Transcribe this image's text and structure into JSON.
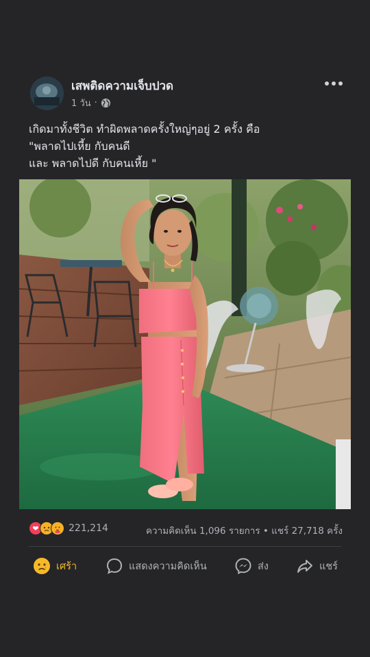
{
  "post": {
    "author": "เสพติดความเจ็บปวด",
    "time": "1 วัน",
    "time_separator": "·",
    "privacy_icon": "globe-icon",
    "more_icon": "more-dots-icon",
    "caption_lines": [
      "เกิดมาทั้งชีวิต ทำผิดพลาดครั้งใหญ่ๆอยู่ 2 ครั้ง คือ",
      "\"พลาดไปเหี้ย กับคนดี",
      "และ พลาดไปดี กับคนเหี้ย \""
    ]
  },
  "engagement": {
    "reaction_icons": [
      "love-reaction-icon",
      "sad-reaction-icon",
      "care-reaction-icon"
    ],
    "reaction_count": "221,214",
    "stats": "ความคิดเห็น 1,096 รายการ • แชร์ 27,718 ครั้ง"
  },
  "actions": {
    "react_label": "เศร้า",
    "comment_label": "แสดงความคิดเห็น",
    "send_label": "ส่ง",
    "share_label": "แชร์"
  },
  "colors": {
    "background": "#252528",
    "active_reaction": "#f7b928",
    "text_primary": "#e4e6eb",
    "text_secondary": "#b0b3b8"
  }
}
